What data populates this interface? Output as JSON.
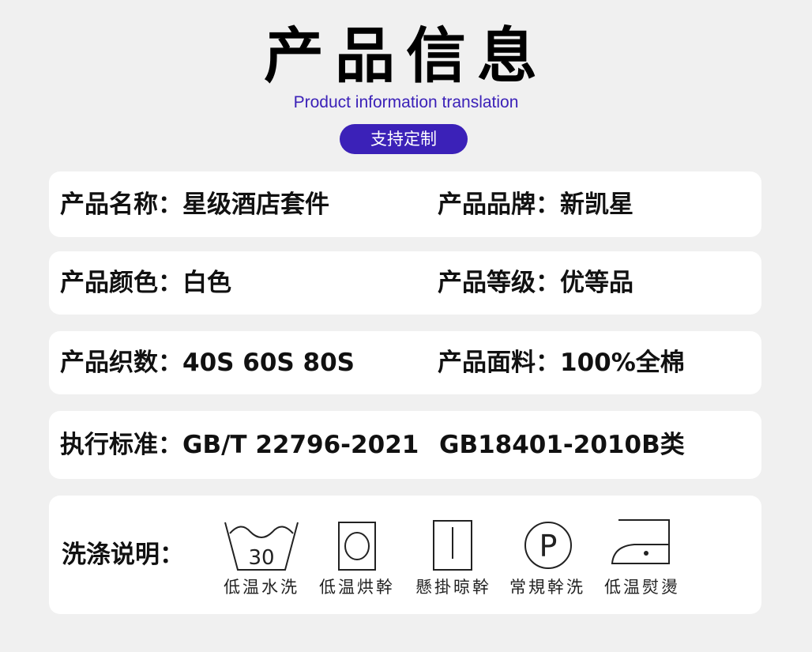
{
  "header": {
    "title": "产品信息",
    "subtitle": "Product information translation",
    "badge": "支持定制"
  },
  "rows": [
    {
      "left": "产品名称：星级酒店套件",
      "right": "产品品牌：新凯星"
    },
    {
      "left": "产品颜色：白色",
      "right": "产品等级：优等品"
    },
    {
      "left": "产品织数：40S  60S  80S",
      "right": "产品面料：100%全棉"
    },
    {
      "left": "执行标准：GB/T 22796-2021",
      "right": "GB18401-2010B类"
    }
  ],
  "washing": {
    "label": "洗涤说明：",
    "symbols": [
      {
        "icon": "wash-30-icon",
        "text": "低温水洗",
        "value": "30"
      },
      {
        "icon": "tumble-dry-low-icon",
        "text": "低温烘幹"
      },
      {
        "icon": "line-dry-icon",
        "text": "懸掛晾幹"
      },
      {
        "icon": "dry-clean-p-icon",
        "text": "常規幹洗",
        "value": "P"
      },
      {
        "icon": "iron-low-icon",
        "text": "低温熨燙"
      }
    ]
  },
  "colors": {
    "accent": "#3b21b8",
    "background": "#f0f0f0",
    "card": "#ffffff"
  }
}
